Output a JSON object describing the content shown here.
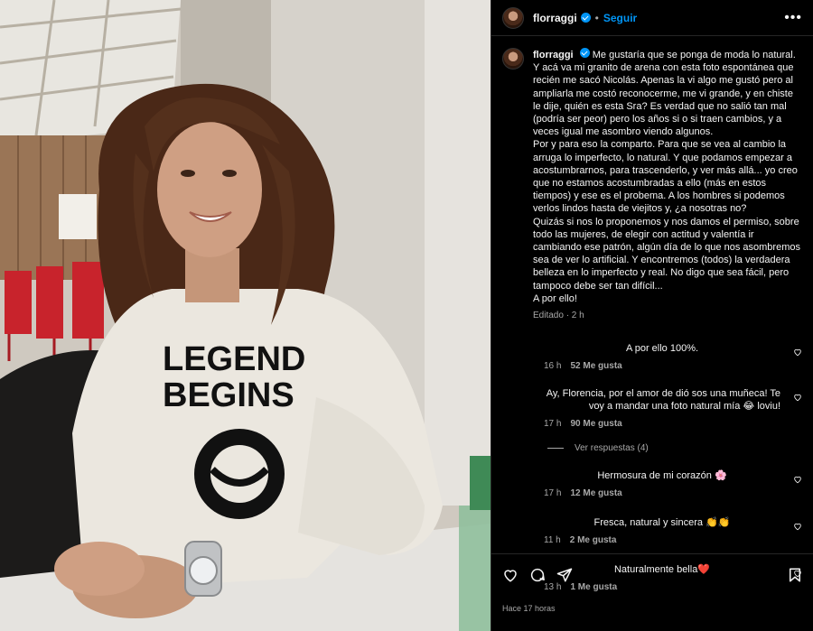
{
  "post": {
    "username": "florraggi",
    "follow_label": "Seguir",
    "more_label": "•••",
    "separator": "•"
  },
  "caption": {
    "username": "florraggi",
    "text": "Me gustaría que se ponga de moda lo natural. Y acá va mi granito de arena con esta foto espontánea que recién me sacó Nicolás. Apenas la vi algo me gustó pero al ampliarla me costó reconocerme, me vi grande, y en chiste le dije, quién es esta Sra? Es verdad que no salió tan mal (podría ser peor) pero los años si o si traen cambios, y a veces igual me asombro viendo algunos.\nPor y para eso la comparto. Para que se vea al cambio la arruga lo imperfecto, lo natural. Y que podamos empezar a acostumbrarnos, para trascenderlo, y ver más allá... yo creo que no estamos acostumbradas a ello (más en estos tiempos) y ese es el probema. A los hombres si podemos verlos lindos hasta de viejitos y, ¿a nosotras no?\nQuizás si nos lo proponemos y nos damos el permiso, sobre todo las mujeres, de elegir con actitud y valentía ir cambiando ese patrón, algún día de lo que nos asombremos sea de ver lo artificial. Y encontremos (todos) la verdadera belleza en lo imperfecto y real. No digo que sea fácil, pero tampoco debe ser tan difícil...\nA por ello!",
    "meta": "Editado · 2 h"
  },
  "comments": [
    {
      "text": "A por ello 100%.",
      "time": "16 h",
      "likes": "52 Me gusta"
    },
    {
      "text": "Ay, Florencia, por el amor de dió sos una muñeca! Te voy a mandar una foto natural mía 😂 loviu!",
      "time": "17 h",
      "likes": "90 Me gusta"
    },
    {
      "text": "Hermosura de mi corazón 🌸",
      "time": "17 h",
      "likes": "12 Me gusta"
    },
    {
      "text": "Fresca, natural y sincera 👏👏",
      "time": "11 h",
      "likes": "2 Me gusta"
    },
    {
      "text": "Naturalmente bella❤️",
      "time": "13 h",
      "likes": "1 Me gusta"
    }
  ],
  "replies_label": "Ver respuestas (4)",
  "timestamp": "Hace 17 horas",
  "photo": {
    "sweater_text_line1": "LEGEND",
    "sweater_text_line2": "BEGINS"
  },
  "icons": [
    "verified-badge-icon",
    "more-icon",
    "heart-icon",
    "comment-icon",
    "share-icon",
    "save-icon"
  ],
  "colors": {
    "accent": "#0095f6",
    "background": "#000000",
    "muted": "#a8a8a8"
  }
}
